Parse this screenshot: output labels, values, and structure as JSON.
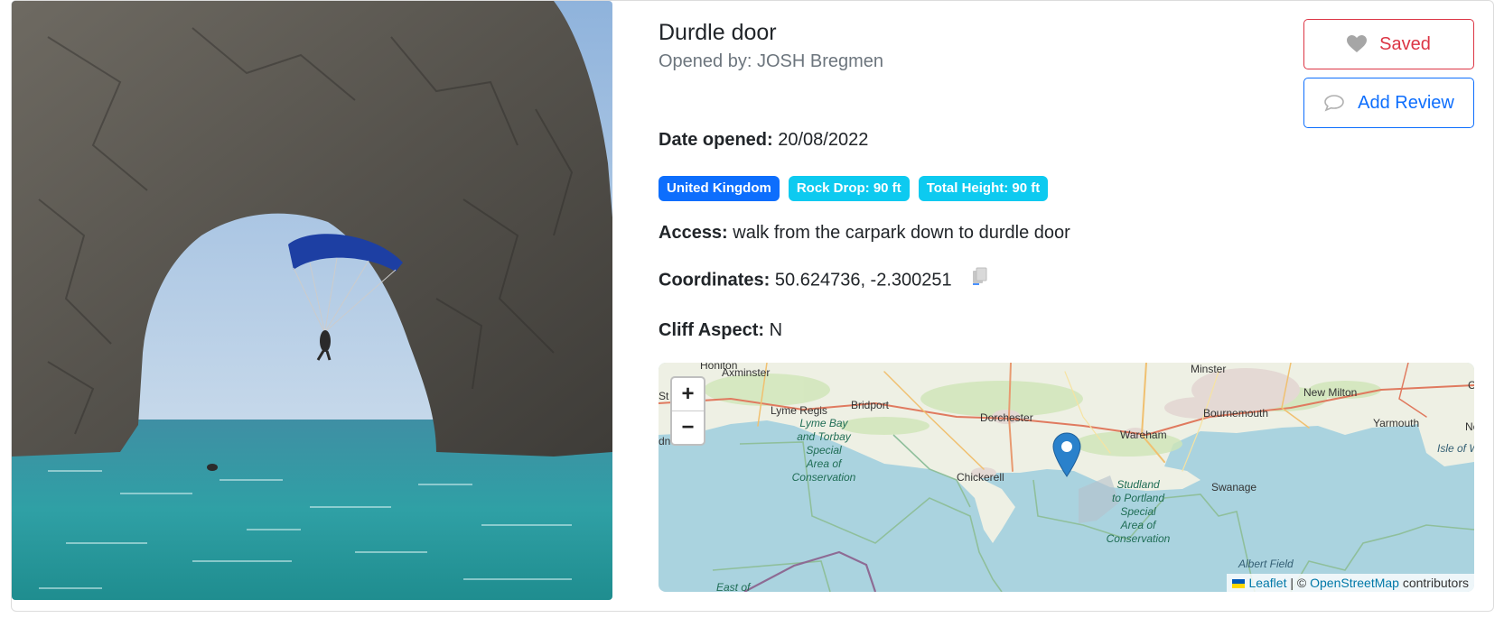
{
  "location": {
    "name": "Durdle door",
    "opened_by": "Opened by: JOSH Bregmen",
    "date_label": "Date opened:",
    "date_value": "20/08/2022",
    "access_label": "Access:",
    "access_value": "walk from the carpark down to durdle door",
    "coords_label": "Coordinates:",
    "coords_value": "50.624736, -2.300251",
    "aspect_label": "Cliff Aspect:",
    "aspect_value": "N"
  },
  "badges": {
    "country": "United Kingdom",
    "rock_drop": "Rock Drop: 90 ft",
    "total_height": "Total Height: 90 ft"
  },
  "buttons": {
    "saved": "Saved",
    "add_review": "Add Review"
  },
  "map": {
    "zoom_in": "+",
    "zoom_out": "−",
    "labels": {
      "honiton": "Honiton",
      "axminster": "Axminster",
      "minster": "Minster",
      "new_milton": "New Milton",
      "bournemouth": "Bournemouth",
      "lyme_regis": "Lyme Regis",
      "bridport": "Bridport",
      "dorchester": "Dorchester",
      "wareham": "Wareham",
      "yarmouth": "Yarmouth",
      "isle_of_wight": "Isle of W",
      "chickerell": "Chickerell",
      "swanage": "Swanage",
      "albert_field": "Albert Field",
      "east_of": "East of",
      "st": "St",
      "dn": "dn",
      "ne": "Ne",
      "c_edge": "C",
      "lyme_bay_l1": "Lyme Bay",
      "lyme_bay_l2": "and Torbay",
      "lyme_bay_l3": "Special",
      "lyme_bay_l4": "Area of",
      "lyme_bay_l5": "Conservation",
      "studland_l1": "Studland",
      "studland_l2": "to Portland",
      "studland_l3": "Special",
      "studland_l4": "Area of",
      "studland_l5": "Conservation"
    },
    "attribution": {
      "leaflet": "Leaflet",
      "separator": " | © ",
      "osm": "OpenStreetMap",
      "contributors": " contributors"
    }
  },
  "icons": {
    "heart": "heart-icon",
    "comment": "chat-icon",
    "copy": "copy-icon",
    "marker": "map-marker-icon"
  },
  "colors": {
    "primary": "#0d6efd",
    "info": "#0dcaf0",
    "danger": "#dc3545",
    "muted": "#6c757d"
  }
}
